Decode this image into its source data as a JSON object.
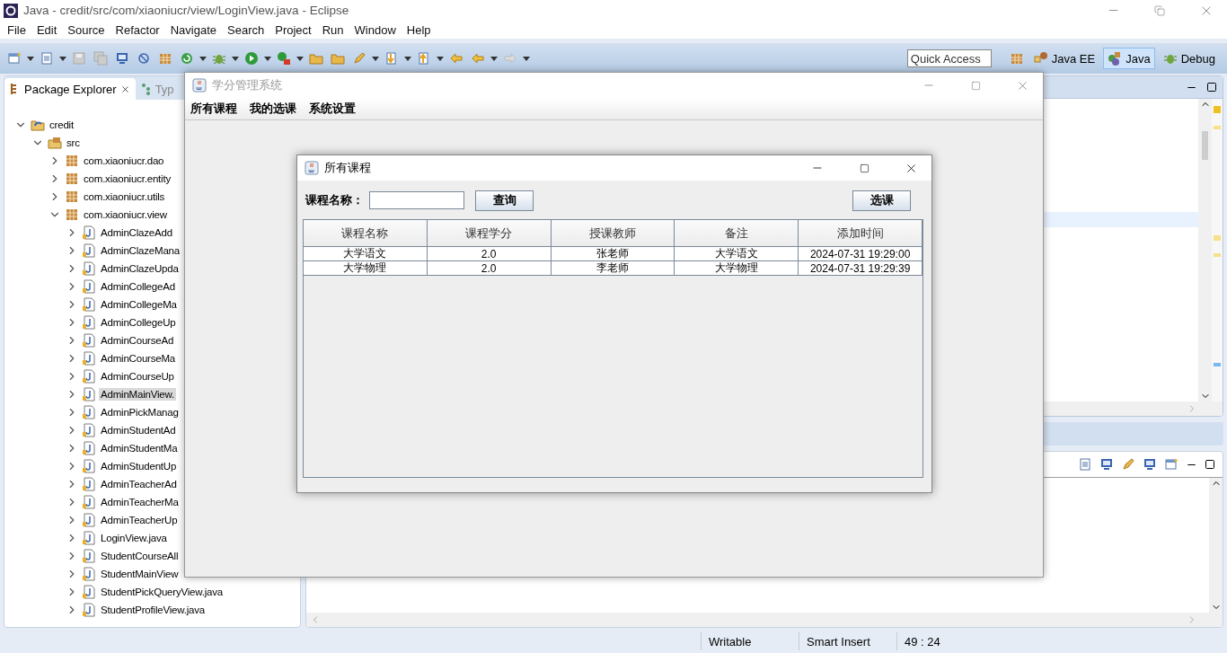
{
  "window": {
    "title": "Java - credit/src/com/xiaoniucr/view/LoginView.java - Eclipse"
  },
  "menu": [
    "File",
    "Edit",
    "Source",
    "Refactor",
    "Navigate",
    "Search",
    "Project",
    "Run",
    "Window",
    "Help"
  ],
  "quick_access": {
    "placeholder": "Quick Access"
  },
  "perspectives": [
    {
      "label": "Java EE",
      "kind": "javaee",
      "selected": false
    },
    {
      "label": "Java",
      "kind": "java",
      "selected": true
    },
    {
      "label": "Debug",
      "kind": "debug",
      "selected": false
    }
  ],
  "left_tabs": [
    {
      "label": "Package Explorer",
      "kind": "explorer",
      "selected": true
    },
    {
      "label": "Typ",
      "kind": "hierarchy",
      "selected": false
    }
  ],
  "tree": [
    {
      "label": "credit",
      "kind": "project",
      "expanded": true,
      "selected": false,
      "children": [
        {
          "label": "src",
          "kind": "folder",
          "expanded": true,
          "selected": false,
          "children": [
            {
              "label": "com.xiaoniucr.dao",
              "kind": "package",
              "expanded": false,
              "selected": false
            },
            {
              "label": "com.xiaoniucr.entity",
              "kind": "package",
              "expanded": false,
              "selected": false
            },
            {
              "label": "com.xiaoniucr.utils",
              "kind": "package",
              "expanded": false,
              "selected": false
            },
            {
              "label": "com.xiaoniucr.view",
              "kind": "package",
              "expanded": true,
              "selected": false,
              "children": [
                {
                  "label": "AdminClazeAdd",
                  "kind": "file",
                  "expanded": false,
                  "selected": false
                },
                {
                  "label": "AdminClazeMana",
                  "kind": "file",
                  "expanded": false,
                  "selected": false
                },
                {
                  "label": "AdminClazeUpda",
                  "kind": "file",
                  "expanded": false,
                  "selected": false
                },
                {
                  "label": "AdminCollegeAd",
                  "kind": "file",
                  "expanded": false,
                  "selected": false
                },
                {
                  "label": "AdminCollegeMa",
                  "kind": "file",
                  "expanded": false,
                  "selected": false
                },
                {
                  "label": "AdminCollegeUp",
                  "kind": "file",
                  "expanded": false,
                  "selected": false
                },
                {
                  "label": "AdminCourseAd",
                  "kind": "file",
                  "expanded": false,
                  "selected": false
                },
                {
                  "label": "AdminCourseMa",
                  "kind": "file",
                  "expanded": false,
                  "selected": false
                },
                {
                  "label": "AdminCourseUp",
                  "kind": "file",
                  "expanded": false,
                  "selected": false
                },
                {
                  "label": "AdminMainView.",
                  "kind": "file",
                  "expanded": false,
                  "selected": true
                },
                {
                  "label": "AdminPickManag",
                  "kind": "file",
                  "expanded": false,
                  "selected": false
                },
                {
                  "label": "AdminStudentAd",
                  "kind": "file",
                  "expanded": false,
                  "selected": false
                },
                {
                  "label": "AdminStudentMa",
                  "kind": "file",
                  "expanded": false,
                  "selected": false
                },
                {
                  "label": "AdminStudentUp",
                  "kind": "file",
                  "expanded": false,
                  "selected": false
                },
                {
                  "label": "AdminTeacherAd",
                  "kind": "file",
                  "expanded": false,
                  "selected": false
                },
                {
                  "label": "AdminTeacherMa",
                  "kind": "file",
                  "expanded": false,
                  "selected": false
                },
                {
                  "label": "AdminTeacherUp",
                  "kind": "file",
                  "expanded": false,
                  "selected": false
                },
                {
                  "label": "LoginView.java",
                  "kind": "file",
                  "expanded": false,
                  "selected": false
                },
                {
                  "label": "StudentCourseAll",
                  "kind": "file",
                  "expanded": false,
                  "selected": false
                },
                {
                  "label": "StudentMainView",
                  "kind": "file",
                  "expanded": false,
                  "selected": false
                },
                {
                  "label": "StudentPickQueryView.java",
                  "kind": "file",
                  "expanded": false,
                  "selected": false
                },
                {
                  "label": "StudentProfileView.java",
                  "kind": "file",
                  "expanded": false,
                  "selected": false
                }
              ]
            }
          ]
        }
      ]
    }
  ],
  "status_bar": [
    "Writable",
    "Smart Insert",
    "49 : 24"
  ],
  "app_window": {
    "title": "学分管理系统",
    "menu": [
      "所有课程",
      "我的选课",
      "系统设置"
    ]
  },
  "dialog": {
    "title": "所有课程",
    "search_label": "课程名称：",
    "query_button": "查询",
    "pick_button": "选课",
    "table": {
      "columns": [
        "课程名称",
        "课程学分",
        "授课教师",
        "备注",
        "添加时间"
      ],
      "rows": [
        [
          "大学语文",
          "2.0",
          "张老师",
          "大学语文",
          "2024-07-31 19:29:00"
        ],
        [
          "大学物理",
          "2.0",
          "李老师",
          "大学物理",
          "2024-07-31 19:29:39"
        ]
      ]
    }
  }
}
